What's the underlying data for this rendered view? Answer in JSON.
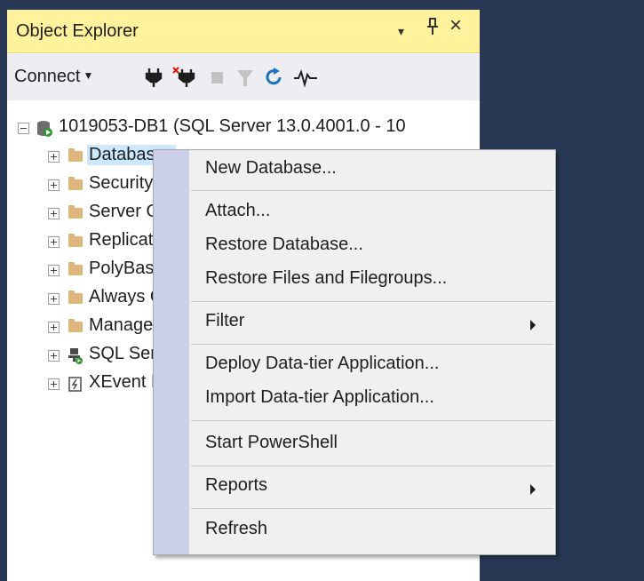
{
  "panel": {
    "title": "Object Explorer",
    "dropdown_icon": "▾",
    "pin_icon": "ᛘ",
    "close_icon": "×"
  },
  "toolbar": {
    "connect_label": "Connect",
    "icons": [
      "connect-plug-icon",
      "disconnect-icon",
      "stop-icon",
      "filter-icon",
      "refresh-icon",
      "activity-monitor-icon"
    ]
  },
  "tree": {
    "server": {
      "label": "1019053-DB1 (SQL Server 13.0.4001.0 - 10"
    },
    "nodes": [
      {
        "label": "Databases",
        "icon": "folder-icon"
      },
      {
        "label": "Security",
        "icon": "folder-icon"
      },
      {
        "label": "Server Objects",
        "icon": "folder-icon"
      },
      {
        "label": "Replication",
        "icon": "folder-icon"
      },
      {
        "label": "PolyBase",
        "icon": "folder-icon"
      },
      {
        "label": "Always On High Availability",
        "icon": "folder-icon"
      },
      {
        "label": "Management",
        "icon": "folder-icon"
      },
      {
        "label": "SQL Server Agent",
        "icon": "sql-agent-icon"
      },
      {
        "label": "XEvent Profiler",
        "icon": "xevent-icon"
      }
    ]
  },
  "context_menu": {
    "items": [
      {
        "label": "New Database..."
      },
      {
        "label": "Attach..."
      },
      {
        "label": "Restore Database..."
      },
      {
        "label": "Restore Files and Filegroups..."
      },
      {
        "label": "Filter",
        "has_submenu": true
      },
      {
        "label": "Deploy Data-tier Application..."
      },
      {
        "label": "Import Data-tier Application..."
      },
      {
        "label": "Start PowerShell"
      },
      {
        "label": "Reports",
        "has_submenu": true
      },
      {
        "label": "Refresh"
      }
    ]
  },
  "colors": {
    "title_bar": "#fff29d",
    "background": "#293955",
    "selection": "#cce8ff",
    "menu_gutter": "#cbcfe8"
  }
}
